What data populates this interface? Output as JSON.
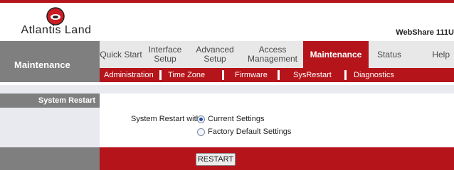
{
  "brand": {
    "logo_text": "Atlantis Land",
    "product_name": "WebShare 111U"
  },
  "section_title": "Maintenance",
  "nav": {
    "items": [
      {
        "label": "Quick Start"
      },
      {
        "label": "Interface Setup"
      },
      {
        "label": "Advanced Setup"
      },
      {
        "label": "Access Management"
      },
      {
        "label": "Maintenance",
        "active": true
      },
      {
        "label": "Status"
      },
      {
        "label": "Help"
      }
    ]
  },
  "subnav": {
    "items": [
      {
        "label": "Administration"
      },
      {
        "label": "Time Zone"
      },
      {
        "label": "Firmware"
      },
      {
        "label": "SysRestart",
        "active": true
      },
      {
        "label": "Diagnostics"
      }
    ]
  },
  "panel": {
    "heading": "System Restart",
    "restart_with_label": "System Restart with :",
    "options": [
      {
        "label": "Current Settings",
        "checked": true
      },
      {
        "label": "Factory Default Settings",
        "checked": false
      }
    ],
    "restart_button": "RESTART"
  },
  "colors": {
    "accent": "#b5141a",
    "gray": "#7f7f7f",
    "light": "#e8eaf0"
  }
}
